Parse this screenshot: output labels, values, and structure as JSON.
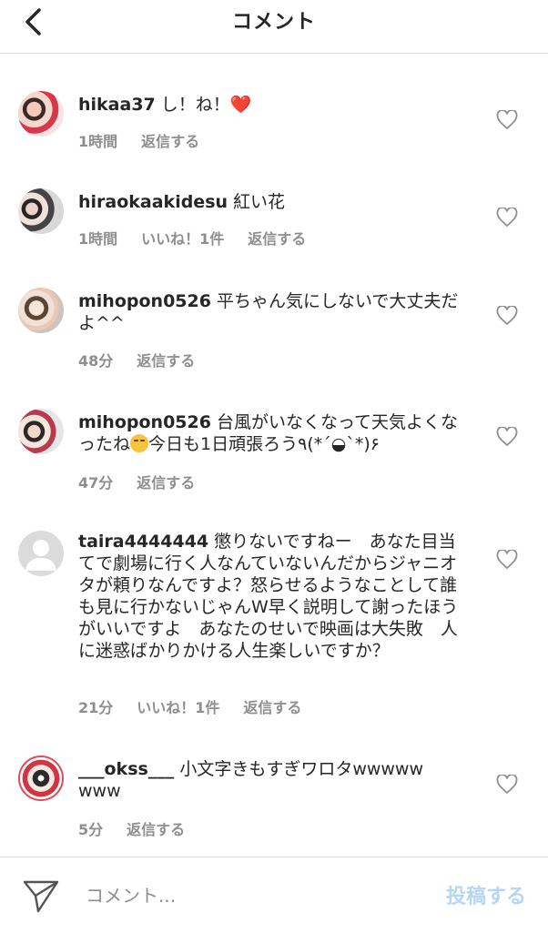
{
  "header": {
    "title": "コメント"
  },
  "comments": [
    {
      "user": "hikaa37",
      "text": "し！ね！",
      "time": "1時間",
      "likes": "",
      "reply": "返信する"
    },
    {
      "user": "hiraokaakidesu",
      "text": "紅い花",
      "time": "1時間",
      "likes": "いいね！1件",
      "reply": "返信する"
    },
    {
      "user": "mihopon0526",
      "text": "平ちゃん気にしないで大丈夫だよ^^",
      "time": "48分",
      "likes": "",
      "reply": "返信する"
    },
    {
      "user": "mihopon0526",
      "text_pre": "台風がいなくなって天気よくなったね",
      "text_post": "今日も1日頑張ろう٩(*´◒`*)۶",
      "time": "47分",
      "likes": "",
      "reply": "返信する"
    },
    {
      "user": "taira4444444",
      "text": "懲りないですねー　あなた目当てで劇場に行く人なんていないんだからジャニオタが頼りなんですよ？怒らせるようなことして誰も見に行かないじゃんW早く説明して謝ったほうがいいですよ　あなたのせいで映画は大失敗　人に迷惑ばかりかける人生楽しいですか？",
      "time": "21分",
      "likes": "いいね！1件",
      "reply": "返信する"
    },
    {
      "user": "___okss___",
      "text": "小文字きもすぎワロタwwwwwwww",
      "time": "5分",
      "likes": "",
      "reply": "返信する"
    }
  ],
  "footer": {
    "placeholder": "コメント...",
    "post_label": "投稿する"
  },
  "colors": {
    "meta": "#8e8e8e",
    "post": "#b6d7f3",
    "heart_red": "#e0243a"
  },
  "icons": {
    "back": "chevron-left-icon",
    "like": "heart-outline-icon",
    "send": "paper-plane-icon"
  }
}
